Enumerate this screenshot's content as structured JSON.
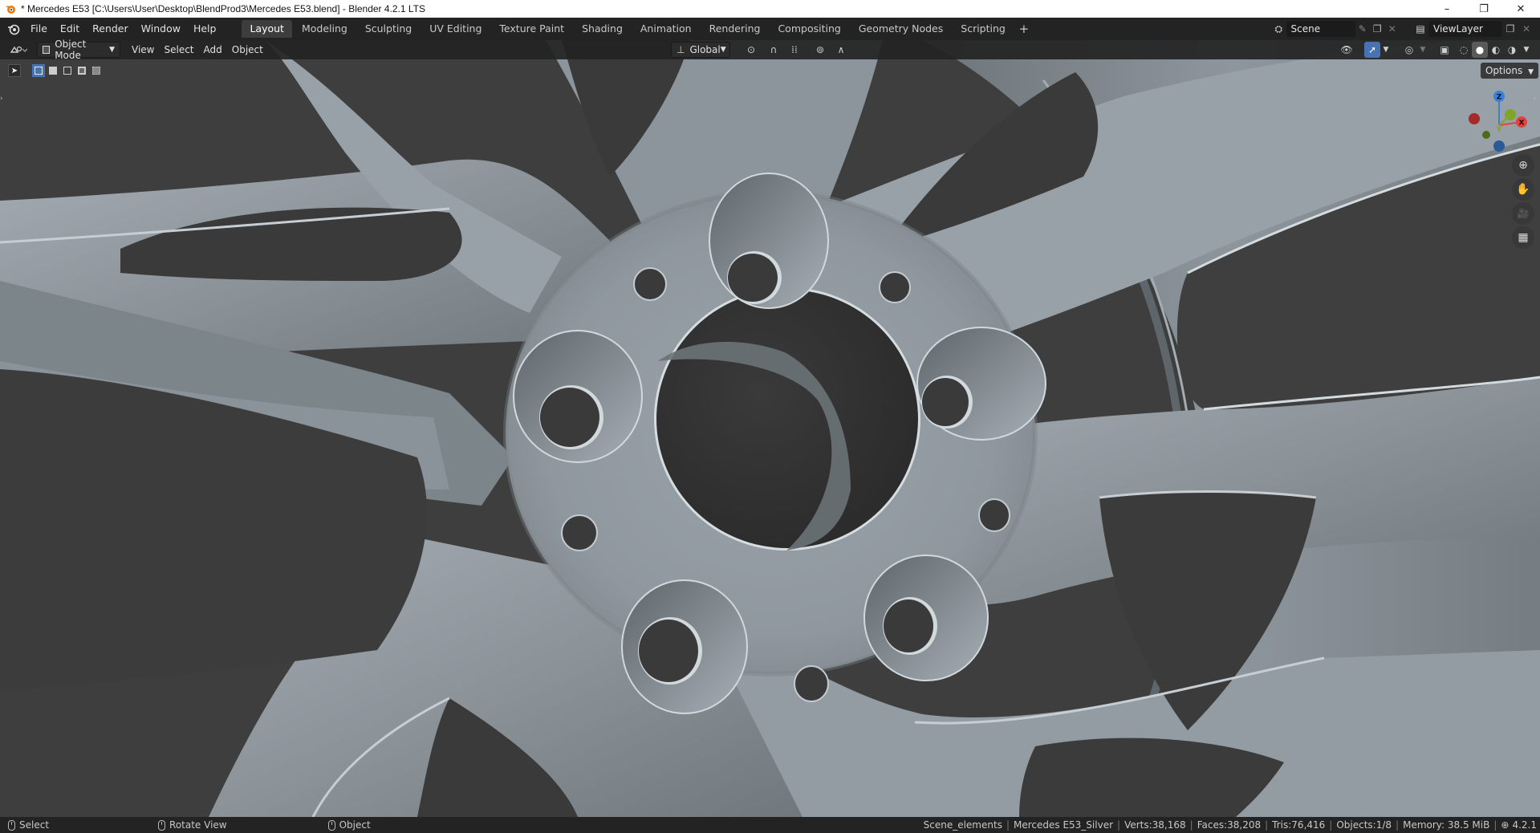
{
  "window": {
    "title": "* Mercedes E53 [C:\\Users\\User\\Desktop\\BlendProd3\\Mercedes E53.blend] - Blender 4.2.1 LTS",
    "controls": {
      "minimize": "–",
      "restore": "❐",
      "close": "✕"
    }
  },
  "menu": [
    "File",
    "Edit",
    "Render",
    "Window",
    "Help"
  ],
  "workspaces": [
    {
      "label": "Layout",
      "active": true
    },
    {
      "label": "Modeling",
      "active": false
    },
    {
      "label": "Sculpting",
      "active": false
    },
    {
      "label": "UV Editing",
      "active": false
    },
    {
      "label": "Texture Paint",
      "active": false
    },
    {
      "label": "Shading",
      "active": false
    },
    {
      "label": "Animation",
      "active": false
    },
    {
      "label": "Rendering",
      "active": false
    },
    {
      "label": "Compositing",
      "active": false
    },
    {
      "label": "Geometry Nodes",
      "active": false
    },
    {
      "label": "Scripting",
      "active": false
    }
  ],
  "add_workspace": "+",
  "scene": {
    "label": "Scene"
  },
  "view_layer": {
    "label": "ViewLayer"
  },
  "viewport_header": {
    "mode": "Object Mode",
    "menus": [
      "View",
      "Select",
      "Add",
      "Object"
    ],
    "orientation": "Global",
    "options": "Options"
  },
  "gizmo": {
    "z": "Z",
    "y": "Y",
    "x": "X"
  },
  "statusbar": {
    "select": "Select",
    "rotate": "Rotate View",
    "object": "Object",
    "collection": "Scene_elements",
    "active_object": "Mercedes E53_Silver",
    "verts": "Verts:38,168",
    "faces": "Faces:38,208",
    "tris": "Tris:76,416",
    "objects": "Objects:1/8",
    "memory": "Memory: 38.5 MiB",
    "version": "4.2.1"
  },
  "colors": {
    "accent": "#4772b3",
    "wheel_surface": "#8e979d",
    "background_dark": "#3c3c3c",
    "axis_x": "#e0443f",
    "axis_y": "#7fa52a",
    "axis_z": "#3d7fd6"
  }
}
